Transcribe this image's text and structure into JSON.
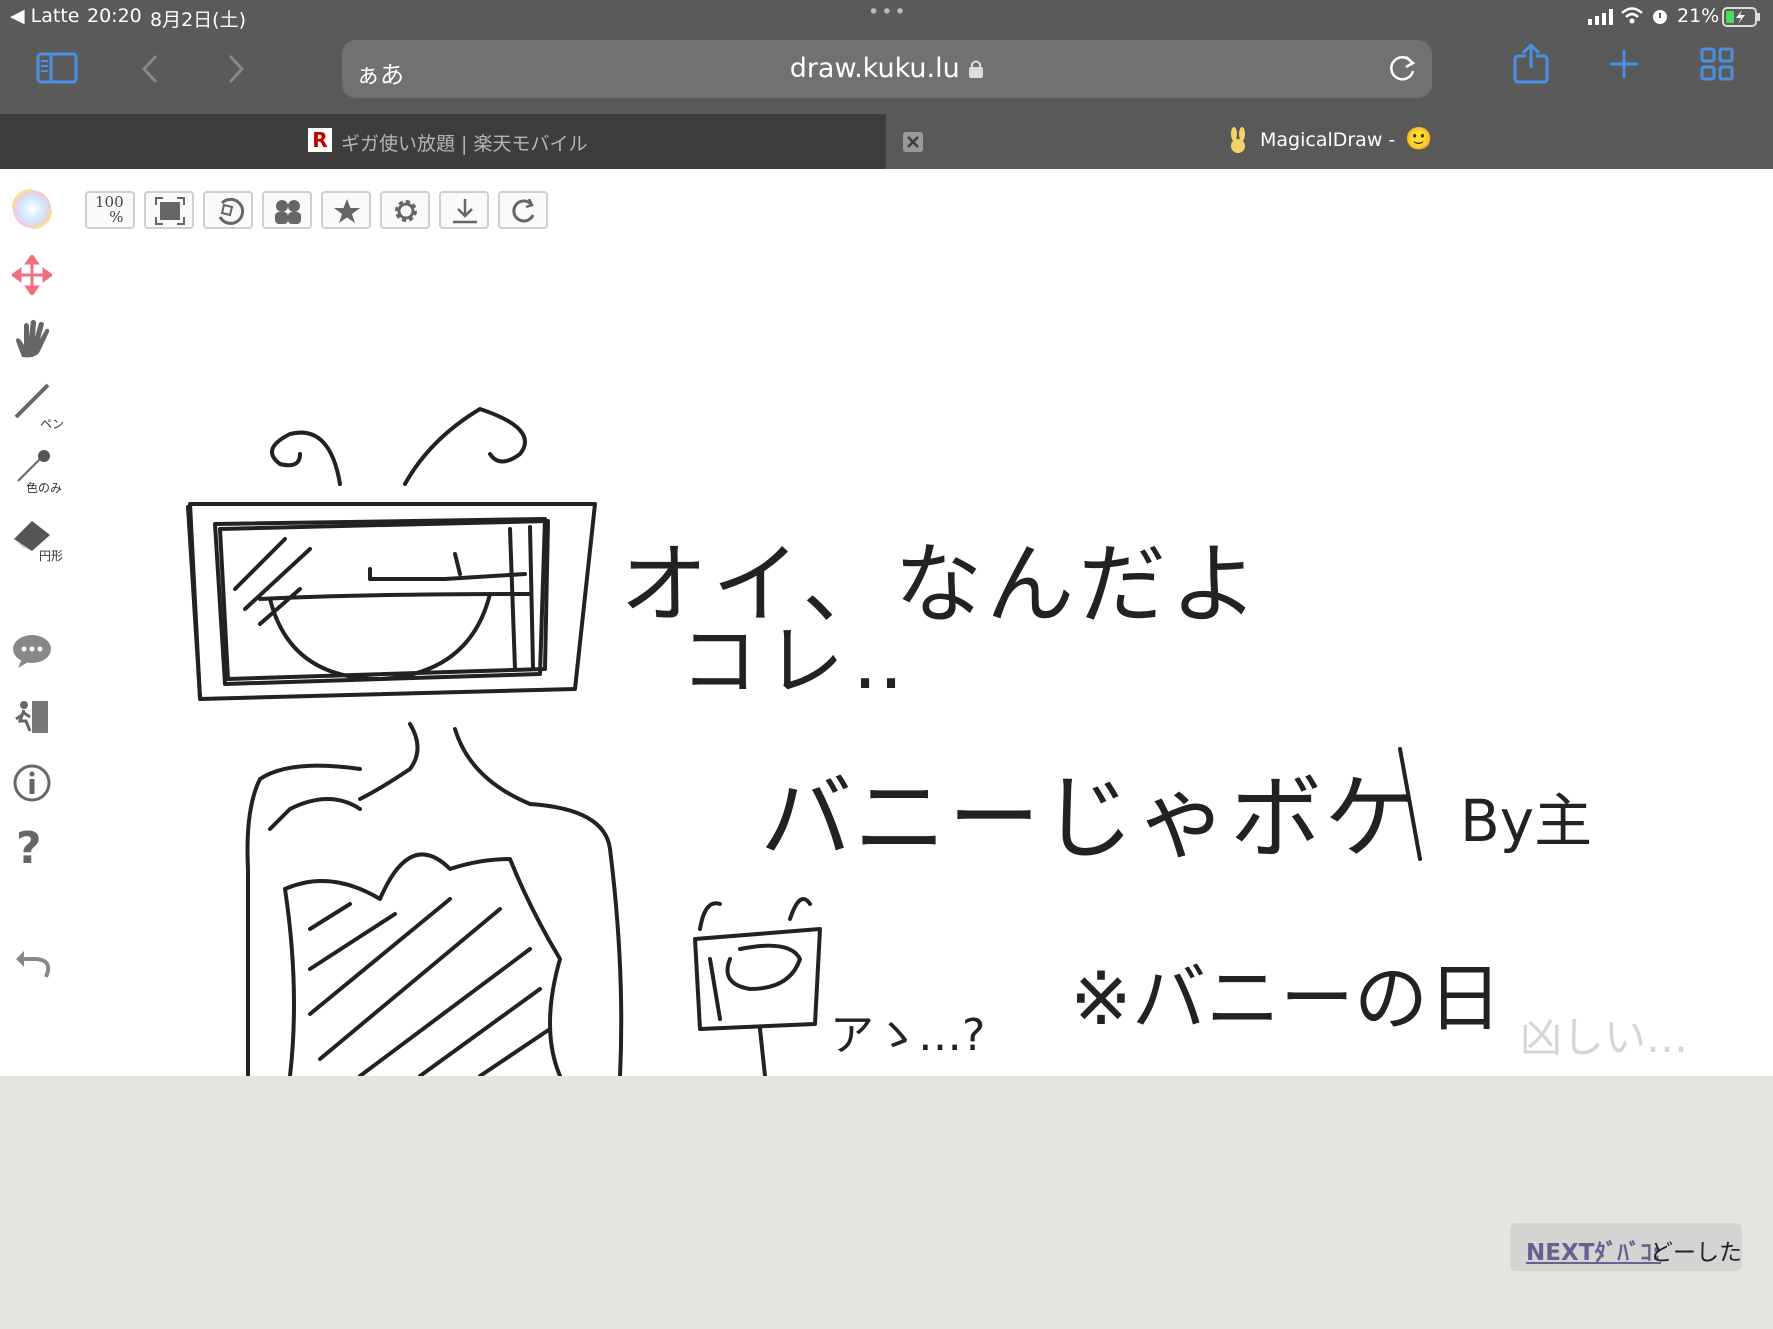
{
  "status_bar": {
    "back_app": "◀ Latte",
    "time": "20:20",
    "date": "8月2日(土)",
    "battery_percent": "21%",
    "multitask_dots": "•••"
  },
  "browser": {
    "aa_label": "ぁあ",
    "url": "draw.kuku.lu",
    "tabs": [
      {
        "favicon": "R",
        "title": "ギガ使い放題 | 楽天モバイル",
        "active": false
      },
      {
        "favicon": "rabbit-icon",
        "title": "MagicalDraw -",
        "emoji": "🙂",
        "active": true
      }
    ],
    "accent_color": "#4a90e2"
  },
  "app": {
    "tools": [
      {
        "name": "color-wheel"
      },
      {
        "name": "move"
      },
      {
        "name": "hand"
      },
      {
        "name": "pen",
        "label": "ペン"
      },
      {
        "name": "eyedropper",
        "label": "色のみ"
      },
      {
        "name": "eraser",
        "label": "円形"
      },
      {
        "name": "chat"
      },
      {
        "name": "exit"
      },
      {
        "name": "info"
      },
      {
        "name": "help"
      },
      {
        "name": "undo"
      }
    ],
    "top_buttons": [
      {
        "name": "zoom-100",
        "label": "100%"
      },
      {
        "name": "fit-screen"
      },
      {
        "name": "rotate"
      },
      {
        "name": "members"
      },
      {
        "name": "favorite"
      },
      {
        "name": "settings"
      },
      {
        "name": "download"
      },
      {
        "name": "refresh"
      }
    ],
    "drawing_text": {
      "line1": "オイ、なんだよ",
      "line2": "コレ‥",
      "line3": "バニーじゃボケ",
      "by": "By主",
      "note": "※バニーの日",
      "small": "アゝ…?",
      "faint": "凶しい…"
    },
    "next_topic": {
      "key": "NEXTﾀﾞﾊﾞｺ:",
      "value": "どーした"
    }
  }
}
